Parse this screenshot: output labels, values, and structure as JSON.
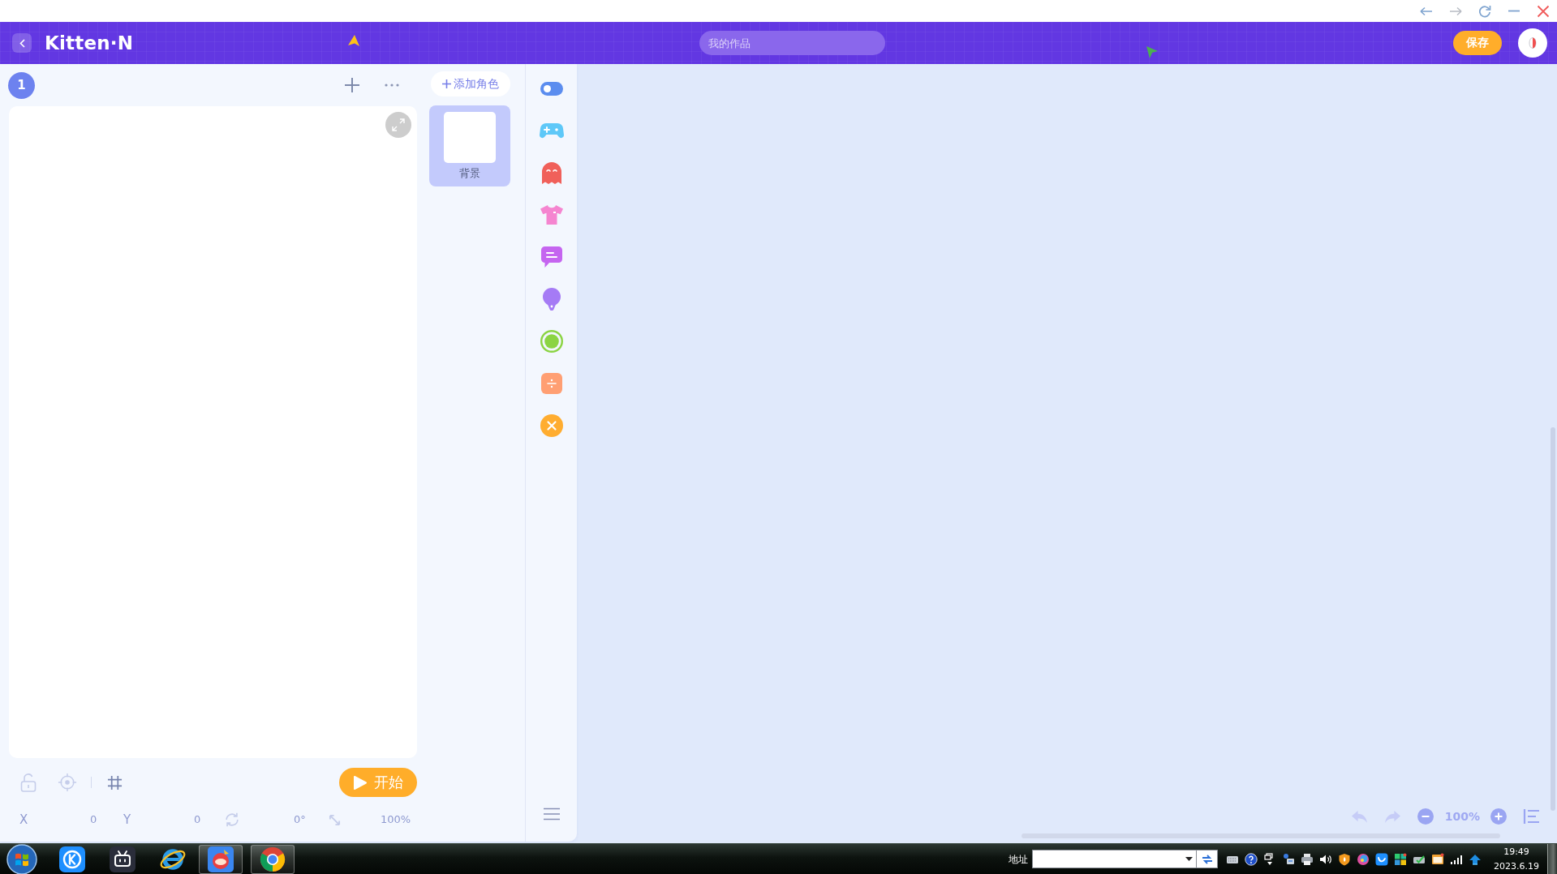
{
  "header": {
    "logo": "Kitten·N",
    "search": {
      "placeholder": "我的作品"
    },
    "save_button": "保存"
  },
  "stage_panel": {
    "scene_badge": "1",
    "start_button": "开始",
    "readout": {
      "x_label": "X",
      "x_value": "0",
      "y_label": "Y",
      "y_value": "0",
      "rotation": "0°",
      "scale": "100%"
    }
  },
  "sprites": {
    "add_button": "添加角色",
    "items": [
      {
        "name": "背景",
        "selected": true
      }
    ]
  },
  "categories": [
    {
      "kind": "toggle",
      "color": "#5b8def"
    },
    {
      "kind": "gamepad",
      "color": "#5ec8f8"
    },
    {
      "kind": "ghost",
      "color": "#f0605a"
    },
    {
      "kind": "shirt",
      "color": "#f585d0"
    },
    {
      "kind": "chat",
      "color": "#c565f0"
    },
    {
      "kind": "bulb",
      "color": "#a57bf5"
    },
    {
      "kind": "ring",
      "color": "#8bd443"
    },
    {
      "kind": "divide",
      "color": "#ff9f73"
    },
    {
      "kind": "cross",
      "color": "#ffad30"
    }
  ],
  "canvas": {
    "zoom": "100%"
  },
  "taskbar": {
    "apps": [
      {
        "kind": "badge",
        "running": false
      },
      {
        "kind": "robot",
        "running": false
      },
      {
        "kind": "orbit",
        "running": false
      },
      {
        "kind": "mascot",
        "running": true
      },
      {
        "kind": "wheel",
        "running": true
      }
    ],
    "address_label": "地址",
    "time": "19:49",
    "date": "2023.6.19"
  }
}
